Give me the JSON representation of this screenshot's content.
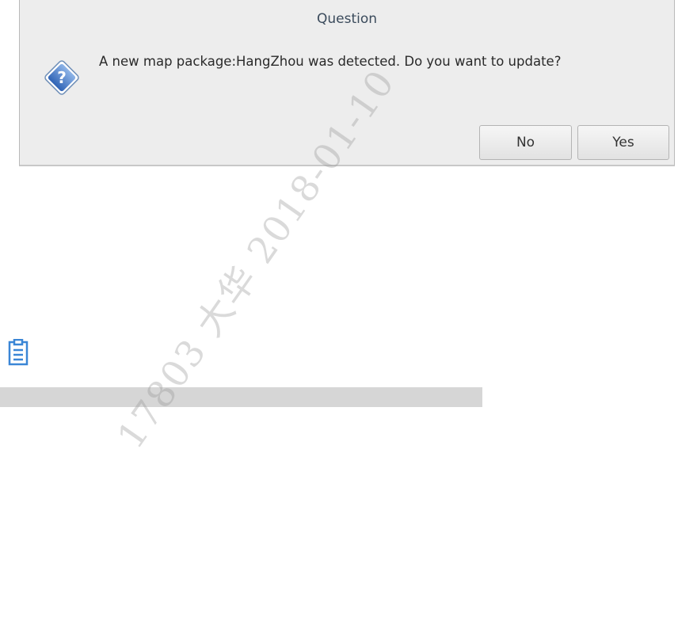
{
  "dialog": {
    "title": "Question",
    "message": "A new map package:HangZhou was detected. Do you want to update?",
    "icon": "question-icon",
    "buttons": {
      "no_label": "No",
      "yes_label": "Yes"
    }
  },
  "page": {
    "note_icon": "clipboard-icon",
    "watermark": "17803 大华 2018-01-10"
  },
  "colors": {
    "dialog_bg": "#ededed",
    "icon_blue": "#3a74c8",
    "bar_grey": "#d6d6d6"
  }
}
